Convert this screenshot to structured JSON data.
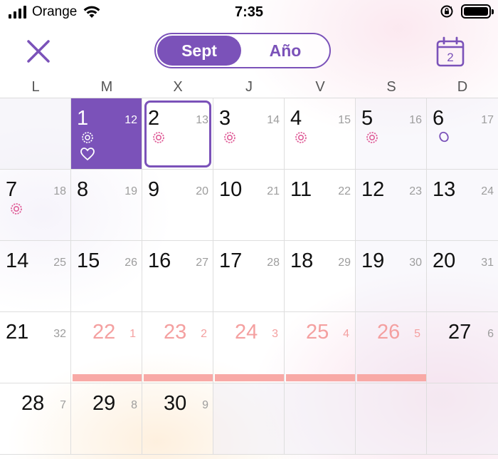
{
  "status_bar": {
    "carrier": "Orange",
    "time": "7:35"
  },
  "toolbar": {
    "segments": [
      {
        "label": "Sept",
        "active": true
      },
      {
        "label": "Año",
        "active": false
      }
    ],
    "calendar_icon_day": "2"
  },
  "weekdays": [
    "L",
    "M",
    "X",
    "J",
    "V",
    "S",
    "D"
  ],
  "colors": {
    "accent": "#7b52b9",
    "period": "#f8a9a6",
    "marker": "#e0609a"
  },
  "calendar": {
    "weeks": [
      [
        {
          "empty": true
        },
        {
          "day": "1",
          "week": "12",
          "selected": true
        },
        {
          "day": "2",
          "week": "13",
          "today": true,
          "marker": true
        },
        {
          "day": "3",
          "week": "14",
          "marker": true
        },
        {
          "day": "4",
          "week": "15",
          "marker": true
        },
        {
          "day": "5",
          "week": "16",
          "marker": true
        },
        {
          "day": "6",
          "week": "17",
          "egg": true
        }
      ],
      [
        {
          "day": "7",
          "week": "18",
          "marker": true
        },
        {
          "day": "8",
          "week": "19"
        },
        {
          "day": "9",
          "week": "20"
        },
        {
          "day": "10",
          "week": "21"
        },
        {
          "day": "11",
          "week": "22"
        },
        {
          "day": "12",
          "week": "23"
        },
        {
          "day": "13",
          "week": "24"
        }
      ],
      [
        {
          "day": "14",
          "week": "25"
        },
        {
          "day": "15",
          "week": "26"
        },
        {
          "day": "16",
          "week": "27"
        },
        {
          "day": "17",
          "week": "28"
        },
        {
          "day": "18",
          "week": "29"
        },
        {
          "day": "19",
          "week": "30"
        },
        {
          "day": "20",
          "week": "31"
        }
      ],
      [
        {
          "day": "21",
          "week": "32"
        },
        {
          "day": "22",
          "week": "1",
          "period": true
        },
        {
          "day": "23",
          "week": "2",
          "period": true
        },
        {
          "day": "24",
          "week": "3",
          "period": true
        },
        {
          "day": "25",
          "week": "4",
          "period": true
        },
        {
          "day": "26",
          "week": "5",
          "period": true
        },
        {
          "day": "27",
          "week": "6",
          "wide": true
        }
      ],
      [
        {
          "day": "28",
          "week": "7",
          "wide": true
        },
        {
          "day": "29",
          "week": "8",
          "wide": true
        },
        {
          "day": "30",
          "week": "9",
          "wide": true
        },
        {
          "empty": true
        },
        {
          "empty": true
        },
        {
          "empty": true
        },
        {
          "empty": true
        }
      ]
    ]
  }
}
